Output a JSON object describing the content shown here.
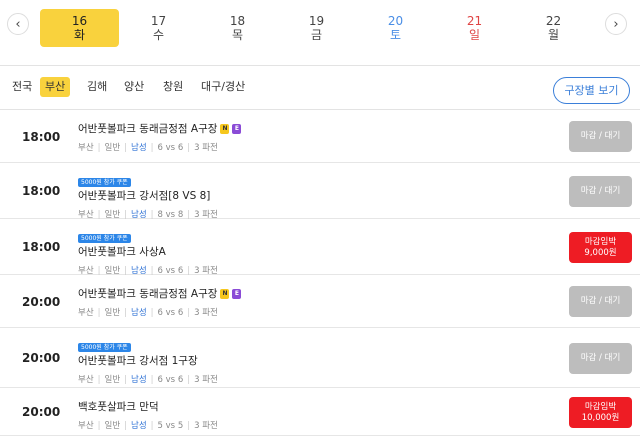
{
  "dates": [
    {
      "day": "16",
      "weekday": "화",
      "type": "active"
    },
    {
      "day": "17",
      "weekday": "수",
      "type": "normal"
    },
    {
      "day": "18",
      "weekday": "목",
      "type": "normal"
    },
    {
      "day": "19",
      "weekday": "금",
      "type": "normal"
    },
    {
      "day": "20",
      "weekday": "토",
      "type": "sat"
    },
    {
      "day": "21",
      "weekday": "일",
      "type": "sun"
    },
    {
      "day": "22",
      "weekday": "월",
      "type": "normal"
    }
  ],
  "nav": {
    "prev_icon": "‹",
    "next_icon": "›"
  },
  "regions": [
    "전국",
    "부산",
    "김해",
    "양산",
    "창원",
    "대구/경산"
  ],
  "active_region": "부산",
  "court_view_label": "구장별 보기",
  "colors": {
    "accent_yellow": "#f9d23d",
    "primary_blue": "#2c86e8",
    "urgent_red": "#ee1c24",
    "closed_gray": "#bdbdbd"
  },
  "matches": [
    {
      "time": "18:00",
      "coupon": "",
      "title": "어반풋볼파크 동래금정점 A구장",
      "tags": [
        "N",
        "E"
      ],
      "region": "부산",
      "level": "일반",
      "gender": "남성",
      "format": "6 vs 6",
      "quarters": "3 파전",
      "status": "closed",
      "status_label": "마감 / 대기",
      "price": ""
    },
    {
      "time": "18:00",
      "coupon": "5000원 참가 쿠폰",
      "title": "어반풋볼파크 강서점[8 VS 8]",
      "tags": [],
      "region": "부산",
      "level": "일반",
      "gender": "남성",
      "format": "8 vs 8",
      "quarters": "3 파전",
      "status": "closed",
      "status_label": "마감 / 대기",
      "price": ""
    },
    {
      "time": "18:00",
      "coupon": "5000원 참가 쿠폰",
      "title": "어반풋볼파크 사상A",
      "tags": [],
      "region": "부산",
      "level": "일반",
      "gender": "남성",
      "format": "6 vs 6",
      "quarters": "3 파전",
      "status": "urgent",
      "status_label": "마감임박",
      "price": "9,000원"
    },
    {
      "time": "20:00",
      "coupon": "",
      "title": "어반풋볼파크 동래금정점 A구장",
      "tags": [
        "N",
        "E"
      ],
      "region": "부산",
      "level": "일반",
      "gender": "남성",
      "format": "6 vs 6",
      "quarters": "3 파전",
      "status": "closed",
      "status_label": "마감 / 대기",
      "price": ""
    },
    {
      "time": "20:00",
      "coupon": "5000원 참가 쿠폰",
      "title": "어반풋볼파크 강서점 1구장",
      "tags": [],
      "region": "부산",
      "level": "일반",
      "gender": "남성",
      "format": "6 vs 6",
      "quarters": "3 파전",
      "status": "closed",
      "status_label": "마감 / 대기",
      "price": ""
    },
    {
      "time": "20:00",
      "coupon": "",
      "title": "백호풋살파크 만덕",
      "tags": [],
      "region": "부산",
      "level": "일반",
      "gender": "남성",
      "format": "5 vs 5",
      "quarters": "3 파전",
      "status": "urgent",
      "status_label": "마감임박",
      "price": "10,000원"
    }
  ]
}
